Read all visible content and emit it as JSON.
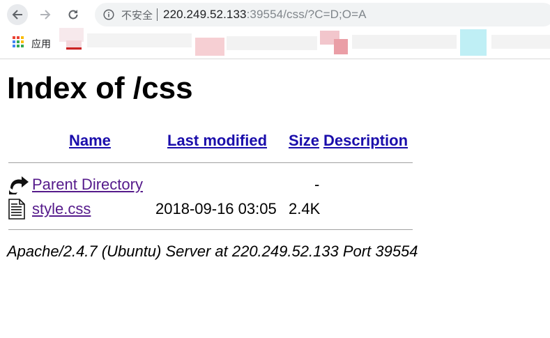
{
  "browser": {
    "security_label": "不安全",
    "url_host": "220.249.52.133",
    "url_rest": ":39554/css/?C=D;O=A",
    "bookmarks_apps_label": "应用"
  },
  "page": {
    "title": "Index of /css",
    "columns": {
      "name": "Name",
      "last_modified": "Last modified",
      "size": "Size",
      "description": "Description"
    },
    "rows": [
      {
        "icon": "back-arrow-icon",
        "name": "Parent Directory",
        "modified": "",
        "size": "-"
      },
      {
        "icon": "text-file-icon",
        "name": "style.css",
        "modified": "2018-09-16 03:05",
        "size": "2.4K"
      }
    ],
    "footer": "Apache/2.4.7 (Ubuntu) Server at 220.249.52.133 Port 39554"
  }
}
